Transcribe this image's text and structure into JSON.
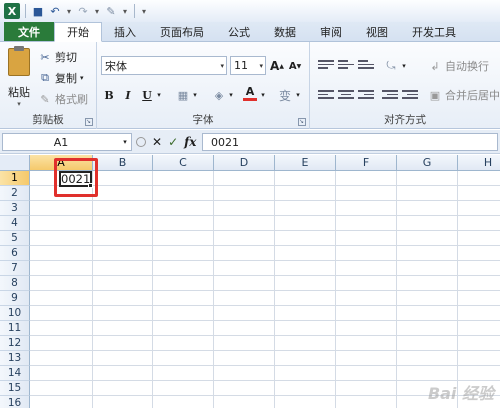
{
  "tabs": [
    "文件",
    "开始",
    "插入",
    "页面布局",
    "公式",
    "数据",
    "审阅",
    "视图",
    "开发工具"
  ],
  "active_tab": "开始",
  "clipboard": {
    "paste_label": "粘贴",
    "cut_label": "剪切",
    "copy_label": "复制",
    "format_painter_label": "格式刷",
    "group_label": "剪贴板"
  },
  "font": {
    "name": "宋体",
    "size": "11",
    "bold": "B",
    "italic": "I",
    "underline": "U",
    "grow": "A",
    "shrink": "A",
    "font_color": "A",
    "wen": "变",
    "group_label": "字体"
  },
  "alignment": {
    "wrap_text_label": "自动换行",
    "merge_label": "合并后居中",
    "group_label": "对齐方式"
  },
  "formula_bar": {
    "name_box": "A1",
    "cancel": "✕",
    "enter": "✓",
    "fx": "fx",
    "content": "0021"
  },
  "grid": {
    "columns": [
      "A",
      "B",
      "C",
      "D",
      "E",
      "F",
      "G",
      "H"
    ],
    "rows": [
      "1",
      "2",
      "3",
      "4",
      "5",
      "6",
      "7",
      "8",
      "9",
      "10",
      "11",
      "12",
      "13",
      "14",
      "15",
      "16"
    ],
    "selected_cell": "A1",
    "cell_a1_value": "0021"
  },
  "watermark": "Bai 经验",
  "colors": {
    "file_tab": "#2a7b3a",
    "selection_header": "#f5c96b",
    "highlight_box": "#e0302c",
    "font_color_bar": "#e0302c"
  }
}
